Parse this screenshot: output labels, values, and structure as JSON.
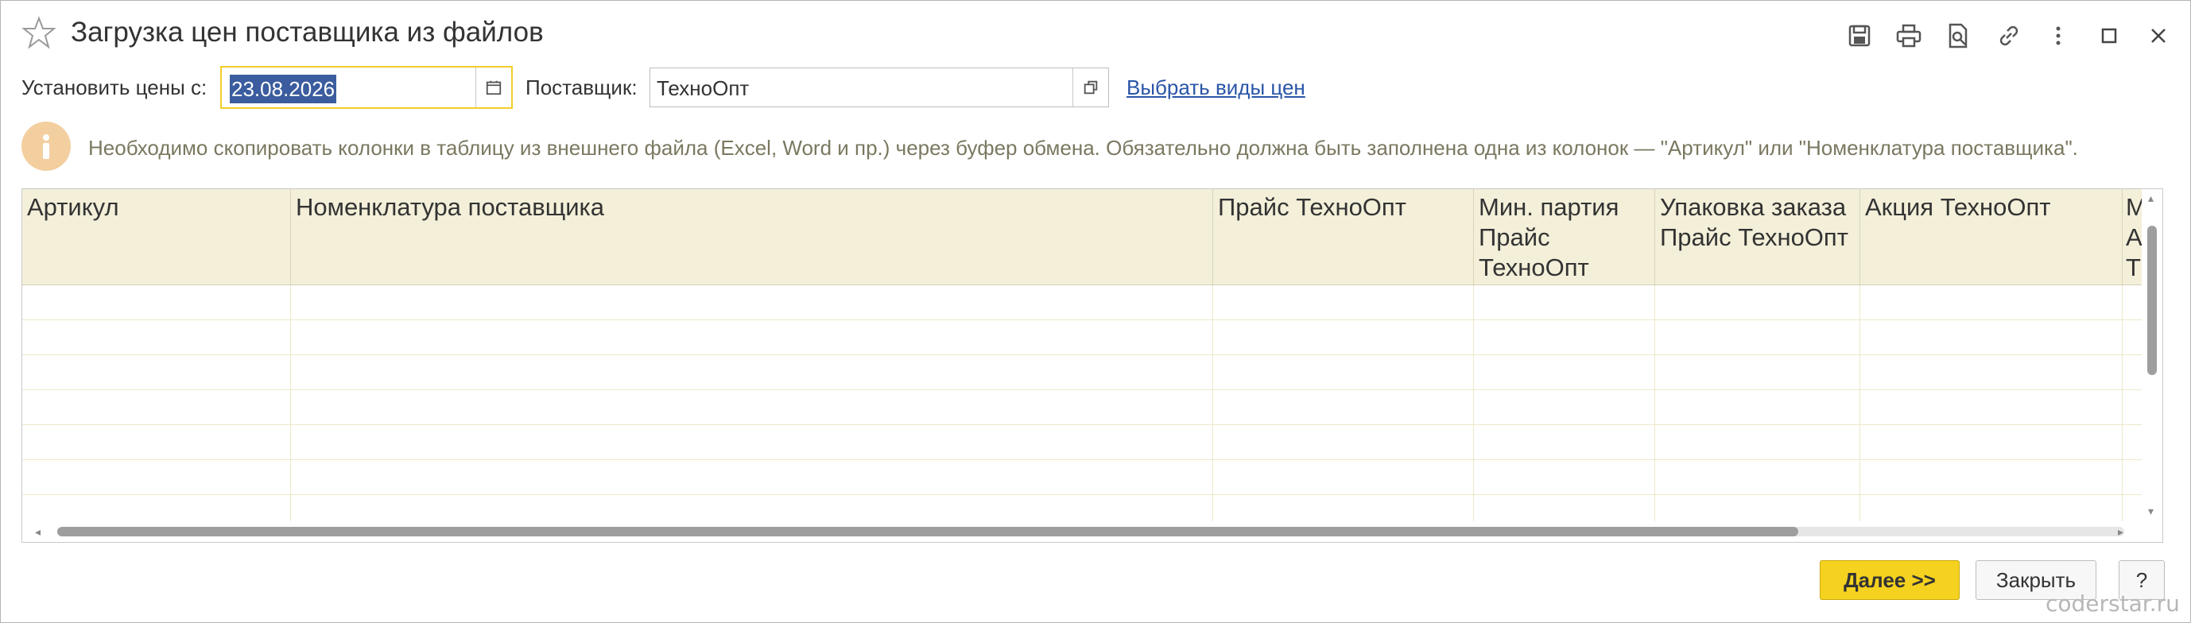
{
  "window": {
    "title": "Загрузка цен поставщика из файлов",
    "toolbar_icons": [
      "save-icon",
      "print-icon",
      "preview-icon",
      "link-icon",
      "more-icon",
      "maximize-icon",
      "close-icon"
    ]
  },
  "form": {
    "date_label": "Установить цены с:",
    "date_value": "23.08.2026",
    "supplier_label": "Поставщик:",
    "supplier_value": "ТехноОпт",
    "select_price_types_link": "Выбрать виды цен"
  },
  "info": {
    "icon": "info-icon",
    "text": "Необходимо скопировать колонки в таблицу из внешнего файла (Excel, Word и пр.) через буфер обмена. Обязательно должна быть заполнена одна из колонок — \"Артикул\" или \"Номенклатура поставщика\"."
  },
  "table": {
    "columns": [
      {
        "label": "Артикул"
      },
      {
        "label": "Номенклатура поставщика"
      },
      {
        "label": "Прайс ТехноОпт"
      },
      {
        "label": "Мин. партия Прайс ТехноОпт"
      },
      {
        "label": "Упаковка заказа Прайс ТехноОпт"
      },
      {
        "label": "Акция ТехноОпт"
      },
      {
        "label": "М А Т"
      }
    ],
    "row_count": 7
  },
  "buttons": {
    "next": "Далее >>",
    "close": "Закрыть",
    "help": "?"
  },
  "watermark": "coderstar.ru",
  "colors": {
    "header_bg": "#f3efd9",
    "accent_yellow": "#f5d21f",
    "link": "#2a55a8",
    "selection": "#3b5c9e",
    "info_icon_bg": "#f3cfa0"
  }
}
